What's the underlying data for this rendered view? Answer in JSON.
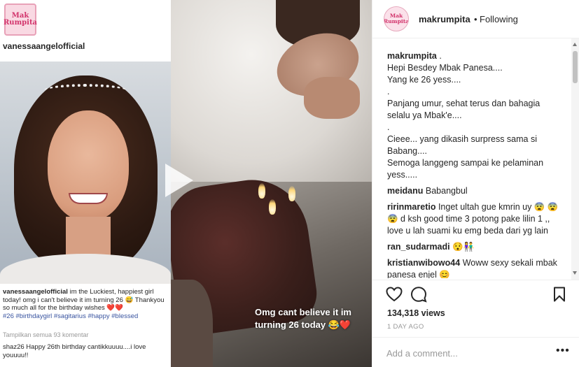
{
  "media": {
    "still": {
      "logo_text": "Mak Rumpita",
      "username": "vanessaangelofficial",
      "caption_user": "vanessaangelofficial",
      "caption_text": "im the Luckiest, happiest girl today! omg i can't believe it im turning 26 😅 Thankyou so much all for the birthday wishes ❤️❤️",
      "caption_tags": "#26 #birthdaygirl #sagitarius #happy #blessed",
      "view_all": "Tampilkan semua 93 komentar",
      "comment_user": "shaz26",
      "comment_text": "Happy 26th birthday cantikkuuuu....i love youuuu!!"
    },
    "overlay_text": "Omg cant believe it im turning 26 today 😂❤️"
  },
  "header": {
    "logo_text": "Mak Rumpita",
    "username": "makrumpita",
    "separator": "•",
    "follow_status": "Following"
  },
  "caption": {
    "user": "makrumpita",
    "first": ".",
    "lines": [
      "Hepi Besdey Mbak Panesa....",
      "Yang ke 26 yess....",
      ".",
      "Panjang umur, sehat terus dan bahagia selalu ya Mbak'e....",
      ".",
      "Cieee... yang dikasih surpress sama si Babang....",
      "Semoga langgeng sampai ke pelaminan yess....."
    ]
  },
  "comments": [
    {
      "user": "meidanu",
      "text": "Babangbul"
    },
    {
      "user": "ririnmaretio",
      "text": "Inget ultah gue kmrin uy 😨 😨😨 d ksh good time 3 potong pake lilin 1 ,, love u lah suami ku emg beda dari yg lain"
    },
    {
      "user": "ran_sudarmadi",
      "text": "😯👫"
    },
    {
      "user": "kristianwibowo44",
      "text": "Woww sexy sekali mbak panesa enjel 😊"
    }
  ],
  "stats": {
    "views": "134,318 views",
    "date": "1 DAY AGO"
  },
  "add_comment": {
    "placeholder": "Add a comment...",
    "more": "•••"
  }
}
